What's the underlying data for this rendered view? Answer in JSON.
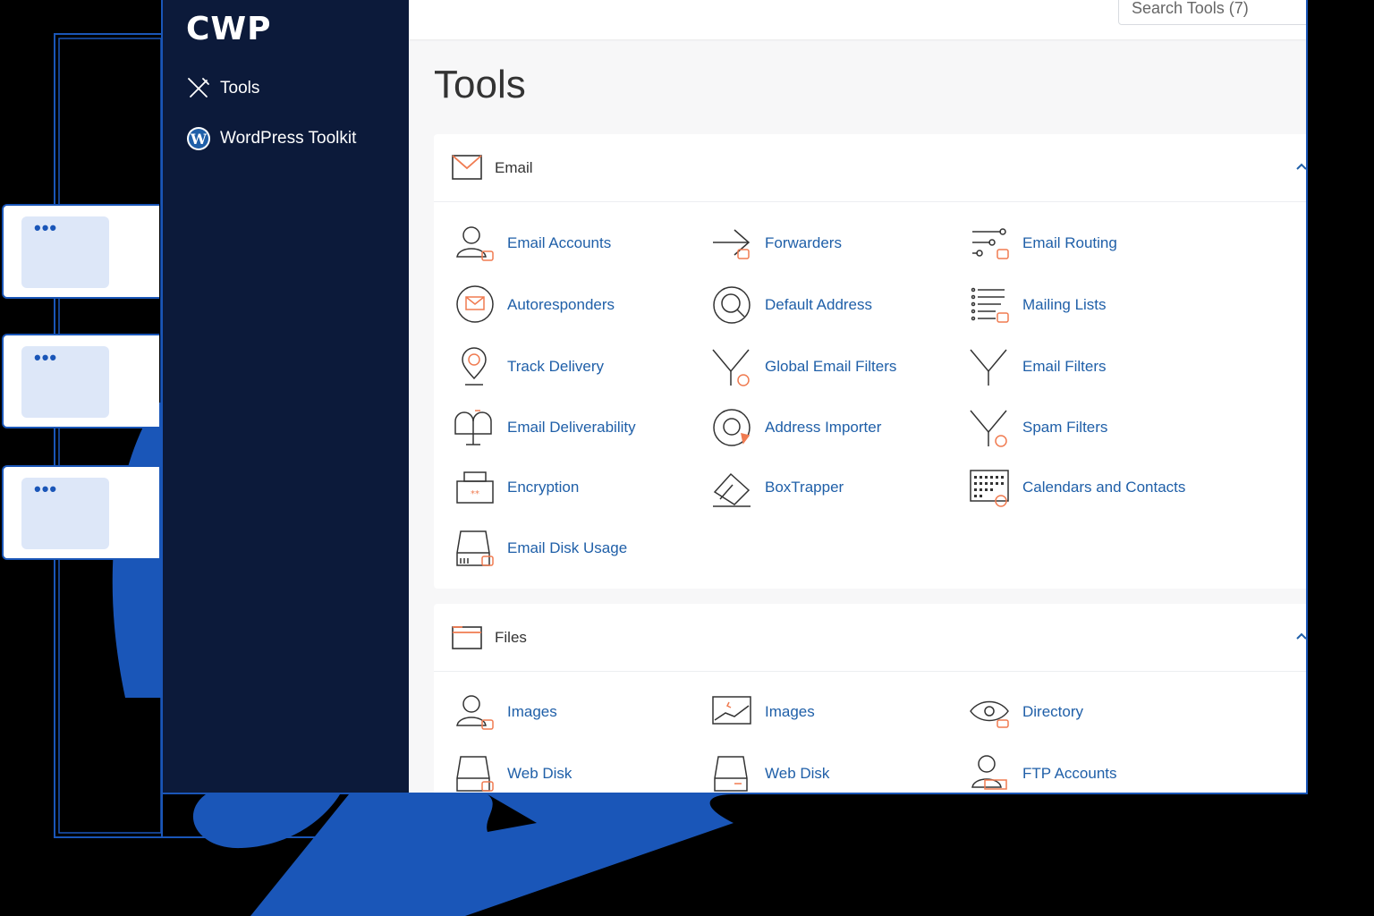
{
  "colors": {
    "accent_blue": "#1a56b8",
    "sidebar_bg": "#0c1a3a",
    "link": "#1f5fa8",
    "icon_orange": "#f07b51"
  },
  "brand": {
    "logo": "CWP"
  },
  "sidebar": {
    "items": [
      {
        "label": "Tools",
        "icon": "tools-icon"
      },
      {
        "label": "WordPress Toolkit",
        "icon": "wordpress-icon"
      }
    ]
  },
  "header": {
    "search_placeholder": "Search Tools (7)"
  },
  "page": {
    "title": "Tools"
  },
  "sections": [
    {
      "title": "Email",
      "icon": "envelope-icon",
      "tools": [
        {
          "label": "Email Accounts",
          "icon": "user-icon"
        },
        {
          "label": "Forwarders",
          "icon": "forward-arrow-icon"
        },
        {
          "label": "Email Routing",
          "icon": "routing-icon"
        },
        {
          "label": "Autoresponders",
          "icon": "autoresponder-icon"
        },
        {
          "label": "Default Address",
          "icon": "at-icon"
        },
        {
          "label": "Mailing Lists",
          "icon": "list-icon"
        },
        {
          "label": "Track Delivery",
          "icon": "location-pin-icon"
        },
        {
          "label": "Global Email Filters",
          "icon": "filter-icon"
        },
        {
          "label": "Email Filters",
          "icon": "filter-icon"
        },
        {
          "label": "Email Deliverability",
          "icon": "mailbox-icon"
        },
        {
          "label": "Address Importer",
          "icon": "importer-icon"
        },
        {
          "label": "Spam Filters",
          "icon": "spam-filter-icon"
        },
        {
          "label": "Encryption",
          "icon": "encryption-icon"
        },
        {
          "label": "BoxTrapper",
          "icon": "boxtrapper-icon"
        },
        {
          "label": "Calendars and Contacts",
          "icon": "calendar-icon"
        },
        {
          "label": "Email Disk Usage",
          "icon": "disk-icon"
        }
      ]
    },
    {
      "title": "Files",
      "icon": "folder-icon",
      "tools": [
        {
          "label": "Images",
          "icon": "user-icon"
        },
        {
          "label": "Images",
          "icon": "image-icon"
        },
        {
          "label": "Directory",
          "icon": "eye-icon"
        },
        {
          "label": "Web Disk",
          "icon": "disk-icon"
        },
        {
          "label": "Web Disk",
          "icon": "disk-icon"
        },
        {
          "label": "FTP Accounts",
          "icon": "ftp-user-icon"
        }
      ]
    }
  ]
}
